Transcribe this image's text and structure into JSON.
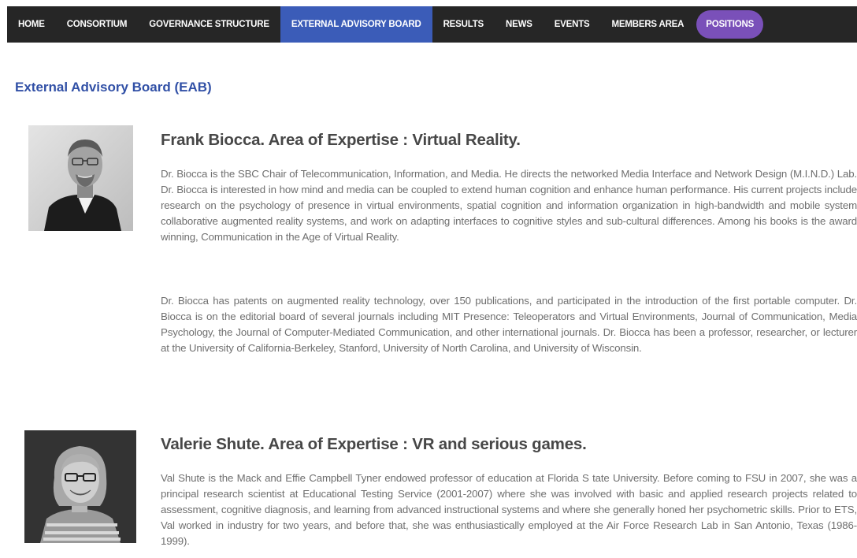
{
  "nav": {
    "items": [
      {
        "label": "HOME"
      },
      {
        "label": "CONSORTIUM"
      },
      {
        "label": "GOVERNANCE STRUCTURE"
      },
      {
        "label": "EXTERNAL ADVISORY BOARD",
        "active": true
      },
      {
        "label": "RESULTS"
      },
      {
        "label": "NEWS"
      },
      {
        "label": "EVENTS"
      },
      {
        "label": "MEMBERS AREA"
      },
      {
        "label": "POSITIONS",
        "highlight": true
      }
    ],
    "colors": {
      "background": "#262626",
      "active": "#3b5cb8",
      "highlight": "#7a50b9",
      "text": "#ffffff"
    }
  },
  "page": {
    "title": "External Advisory Board (EAB)",
    "title_color": "#3150a6"
  },
  "members": [
    {
      "name": "Frank Biocca. Area of Expertise : Virtual Reality.",
      "photo_icon": "portrait-man-bw",
      "bio": [
        "Dr. Biocca is the SBC Chair of Telecommunication, Information, and Media. He directs the networked Media Interface and Network Design (M.I.N.D.) Lab. Dr. Biocca is interested in how mind and media can be coupled to extend human cognition and enhance human performance. His current projects include research on the psychology of presence in virtual environments, spatial cognition and information organization in high-bandwidth and mobile system collaborative augmented reality systems, and work on adapting interfaces to cognitive styles and sub-cultural differences. Among his books is the award winning, Communication in the Age of Virtual Reality.",
        "Dr. Biocca has patents on augmented reality technology, over 150 publications, and participated in the introduction of the first portable computer. Dr. Biocca is on the editorial board of several journals including MIT Presence: Teleoperators and Virtual Environments, Journal of Communication, Media Psychology, the Journal of Computer-Mediated Communication, and other international journals. Dr. Biocca has been a professor, researcher, or lecturer at the University of California-Berkeley, Stanford, University of North Carolina, and University of Wisconsin."
      ]
    },
    {
      "name": "Valerie Shute. Area of Expertise : VR and serious games.",
      "photo_icon": "portrait-woman-bw",
      "bio": [
        "Val Shute is the Mack and Effie Campbell Tyner endowed professor of education at Florida S  tate University. Before coming to FSU in 2007, she was a principal research scientist at Educational Testing Service (2001-2007) where she was involved with basic and applied research projects related to assessment, cognitive diagnosis, and learning from advanced instructional systems and where she generally honed her psychometric skills. Prior to ETS, Val worked in industry for two years, and before that, she was enthusiastically employed at the Air Force Research Lab in San Antonio, Texas (1986-1999)."
      ]
    }
  ]
}
